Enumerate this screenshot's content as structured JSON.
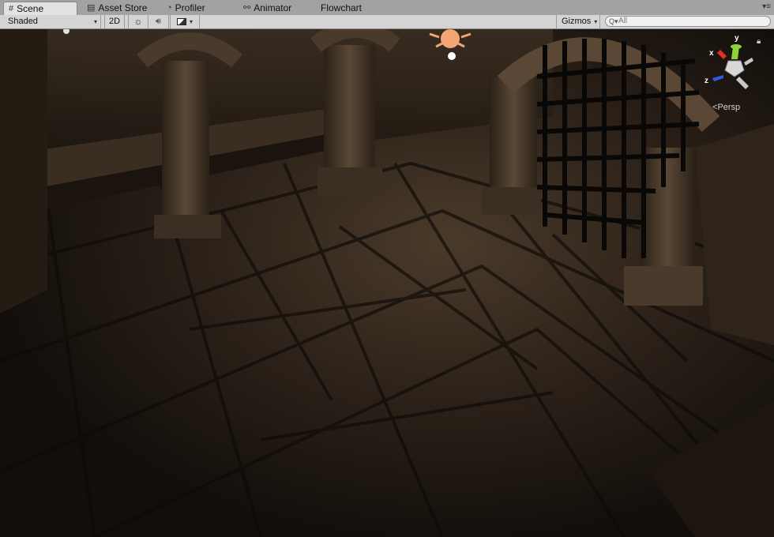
{
  "tabs": [
    {
      "label": "Scene",
      "icon": "grid-icon",
      "active": true
    },
    {
      "label": "Asset Store",
      "icon": "store-icon",
      "active": false
    },
    {
      "label": "Profiler",
      "icon": "profiler-icon",
      "active": false
    },
    {
      "label": "Animator",
      "icon": "animator-icon",
      "active": false
    },
    {
      "label": "Flowchart",
      "icon": "",
      "active": false
    }
  ],
  "toolbar": {
    "shading_mode": "Shaded",
    "two_d_label": "2D",
    "gizmos_label": "Gizmos",
    "search_placeholder": "All"
  },
  "viewport": {
    "projection_label": "Persp",
    "axis_labels": {
      "x": "x",
      "y": "y",
      "z": "z"
    }
  },
  "colors": {
    "tab_bar": "#a2a2a2",
    "toolbar": "#d4d4d4",
    "axis_x": "#e0302a",
    "axis_y": "#8cd43a",
    "axis_z": "#2e5be0"
  }
}
